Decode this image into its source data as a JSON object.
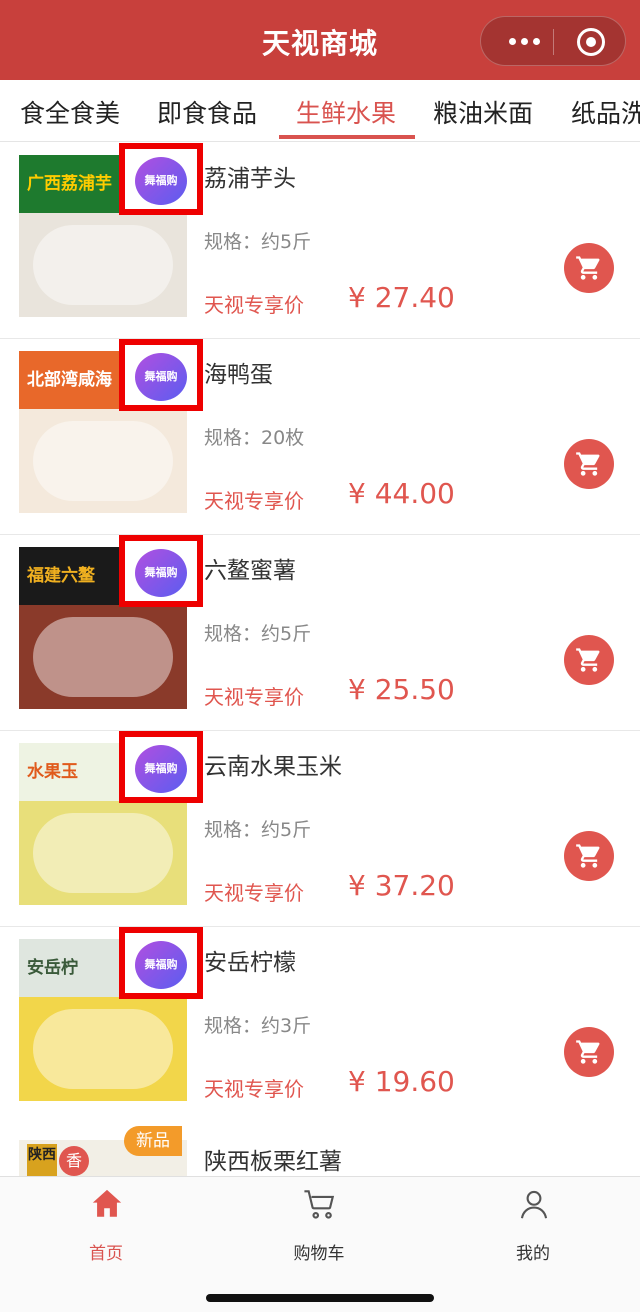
{
  "app": {
    "title": "天视商城"
  },
  "tabs": [
    {
      "label": "食全食美",
      "active": false
    },
    {
      "label": "即食食品",
      "active": false
    },
    {
      "label": "生鲜水果",
      "active": true
    },
    {
      "label": "粮油米面",
      "active": false
    },
    {
      "label": "纸品洗",
      "active": false
    }
  ],
  "products": [
    {
      "name": "荔浦芋头",
      "spec": "规格：约5斤",
      "price_label": "天视专享价",
      "price": "¥ 27.40",
      "badge": "舞福购",
      "banner_text": "广西荔浦芋",
      "banner_color": "#1e7a2e",
      "banner_text_color": "#ffcc00",
      "body_color": "#e9e4dc"
    },
    {
      "name": "海鸭蛋",
      "spec": "规格：20枚",
      "price_label": "天视专享价",
      "price": "¥ 44.00",
      "badge": "舞福购",
      "banner_text": "北部湾咸海",
      "banner_color": "#e8682a",
      "banner_text_color": "#ffffff",
      "body_color": "#f4e9dc"
    },
    {
      "name": "六鳌蜜薯",
      "spec": "规格：约5斤",
      "price_label": "天视专享价",
      "price": "¥ 25.50",
      "badge": "舞福购",
      "banner_text": "福建六鳌",
      "banner_color": "#1a1a1a",
      "banner_text_color": "#f0b020",
      "body_color": "#8a3a2a"
    },
    {
      "name": "云南水果玉米",
      "spec": "规格：约5斤",
      "price_label": "天视专享价",
      "price": "¥ 37.20",
      "badge": "舞福购",
      "banner_text": "水果玉",
      "banner_color": "#eef3e3",
      "banner_text_color": "#e05a1c",
      "body_color": "#e8df7a"
    },
    {
      "name": "安岳柠檬",
      "spec": "规格：约3斤",
      "price_label": "天视专享价",
      "price": "¥ 19.60",
      "badge": "舞福购",
      "banner_text": "安岳柠",
      "banner_color": "#dfe6df",
      "banner_text_color": "#3a5a3a",
      "body_color": "#f2d64a"
    }
  ],
  "partial_product": {
    "name": "陕西板栗红薯",
    "tag": "新品",
    "thumb_text": "陕西",
    "thumb_sub": "香"
  },
  "bottom_nav": [
    {
      "label": "首页",
      "icon": "home-icon",
      "active": true
    },
    {
      "label": "购物车",
      "icon": "cart-icon",
      "active": false
    },
    {
      "label": "我的",
      "icon": "user-icon",
      "active": false
    }
  ],
  "colors": {
    "header": "#c8403c",
    "accent": "#e0564f",
    "badge_border": "#ee0000"
  }
}
